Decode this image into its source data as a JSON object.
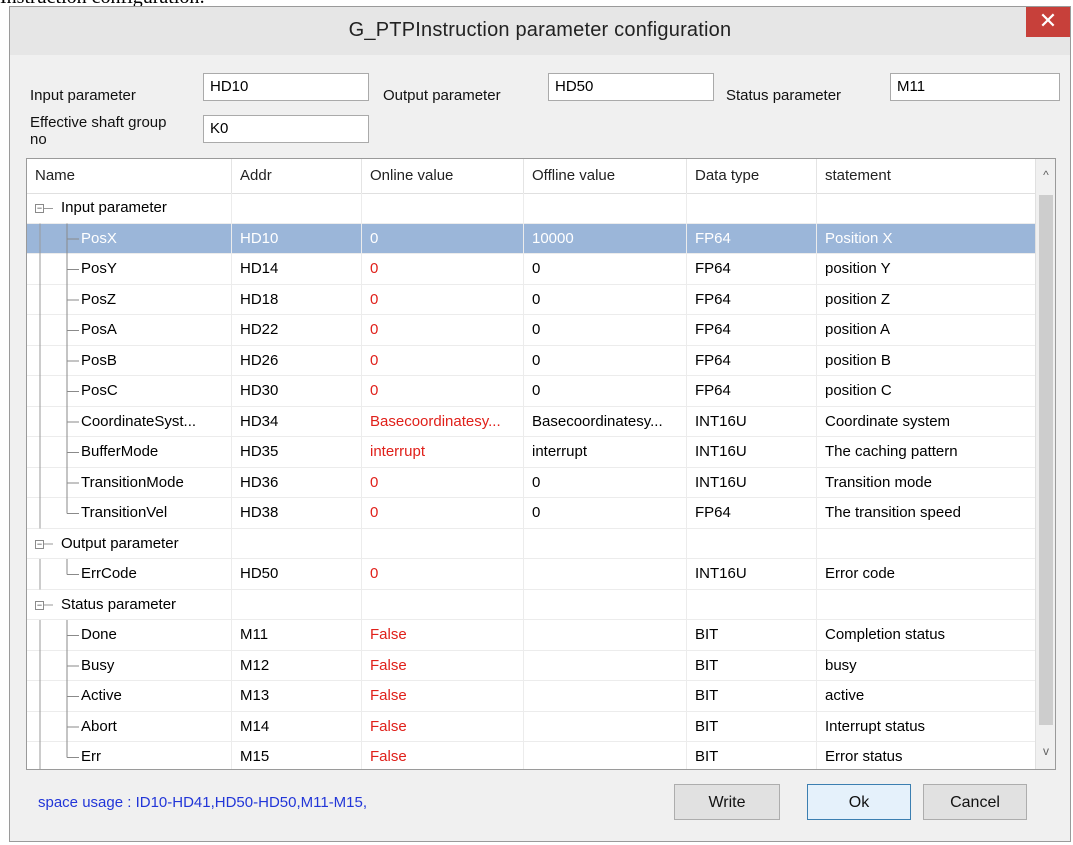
{
  "caption": "Instruction configuration:",
  "window": {
    "title": "G_PTPInstruction parameter configuration",
    "close_glyph": "✕"
  },
  "params": {
    "input_label": "Input parameter",
    "input_value": "HD10",
    "output_label": "Output parameter",
    "output_value": "HD50",
    "status_label": "Status parameter",
    "status_value": "M11",
    "shaft_label": "Effective shaft group no",
    "shaft_value": "K0"
  },
  "grid": {
    "columns": [
      "Name",
      "Addr",
      "Online value",
      "Offline value",
      "Data type",
      "statement"
    ],
    "rows": [
      {
        "kind": "group",
        "name": "Input parameter"
      },
      {
        "kind": "item",
        "name": "PosX",
        "addr": "HD10",
        "online": "0",
        "offline": "10000",
        "dtype": "FP64",
        "statement": "Position X",
        "selected": true
      },
      {
        "kind": "item",
        "name": "PosY",
        "addr": "HD14",
        "online": "0",
        "offline": "0",
        "dtype": "FP64",
        "statement": "position Y"
      },
      {
        "kind": "item",
        "name": "PosZ",
        "addr": "HD18",
        "online": "0",
        "offline": "0",
        "dtype": "FP64",
        "statement": "position Z"
      },
      {
        "kind": "item",
        "name": "PosA",
        "addr": "HD22",
        "online": "0",
        "offline": "0",
        "dtype": "FP64",
        "statement": "position A"
      },
      {
        "kind": "item",
        "name": "PosB",
        "addr": "HD26",
        "online": "0",
        "offline": "0",
        "dtype": "FP64",
        "statement": "position B"
      },
      {
        "kind": "item",
        "name": "PosC",
        "addr": "HD30",
        "online": "0",
        "offline": "0",
        "dtype": "FP64",
        "statement": "position C"
      },
      {
        "kind": "item",
        "name": "CoordinateSyst...",
        "addr": "HD34",
        "online": "Basecoordinatesy...",
        "offline": "Basecoordinatesy...",
        "dtype": "INT16U",
        "statement": "Coordinate system"
      },
      {
        "kind": "item",
        "name": "BufferMode",
        "addr": "HD35",
        "online": "interrupt",
        "offline": "interrupt",
        "dtype": "INT16U",
        "statement": "The caching pattern"
      },
      {
        "kind": "item",
        "name": "TransitionMode",
        "addr": "HD36",
        "online": "0",
        "offline": "0",
        "dtype": "INT16U",
        "statement": "Transition mode"
      },
      {
        "kind": "item",
        "name": "TransitionVel",
        "addr": "HD38",
        "online": "0",
        "offline": "0",
        "dtype": "FP64",
        "statement": "The transition speed",
        "last": true
      },
      {
        "kind": "group",
        "name": "Output parameter"
      },
      {
        "kind": "item",
        "name": "ErrCode",
        "addr": "HD50",
        "online": "0",
        "offline": "",
        "dtype": "INT16U",
        "statement": "Error code",
        "last": true
      },
      {
        "kind": "group",
        "name": "Status parameter"
      },
      {
        "kind": "item",
        "name": "Done",
        "addr": "M11",
        "online": "False",
        "offline": "",
        "dtype": "BIT",
        "statement": "Completion status"
      },
      {
        "kind": "item",
        "name": "Busy",
        "addr": "M12",
        "online": "False",
        "offline": "",
        "dtype": "BIT",
        "statement": "busy"
      },
      {
        "kind": "item",
        "name": "Active",
        "addr": "M13",
        "online": "False",
        "offline": "",
        "dtype": "BIT",
        "statement": "active"
      },
      {
        "kind": "item",
        "name": "Abort",
        "addr": "M14",
        "online": "False",
        "offline": "",
        "dtype": "BIT",
        "statement": "Interrupt status"
      },
      {
        "kind": "item",
        "name": "Err",
        "addr": "M15",
        "online": "False",
        "offline": "",
        "dtype": "BIT",
        "statement": "Error status",
        "last": true
      }
    ]
  },
  "footer": {
    "usage": "space usage : ID10-HD41,HD50-HD50,M11-M15,",
    "write_label": "Write",
    "ok_label": "Ok",
    "cancel_label": "Cancel"
  },
  "colors": {
    "selected_row": "#9bb6d9",
    "online_value": "#e0201a",
    "usage_text": "#2236d8"
  }
}
